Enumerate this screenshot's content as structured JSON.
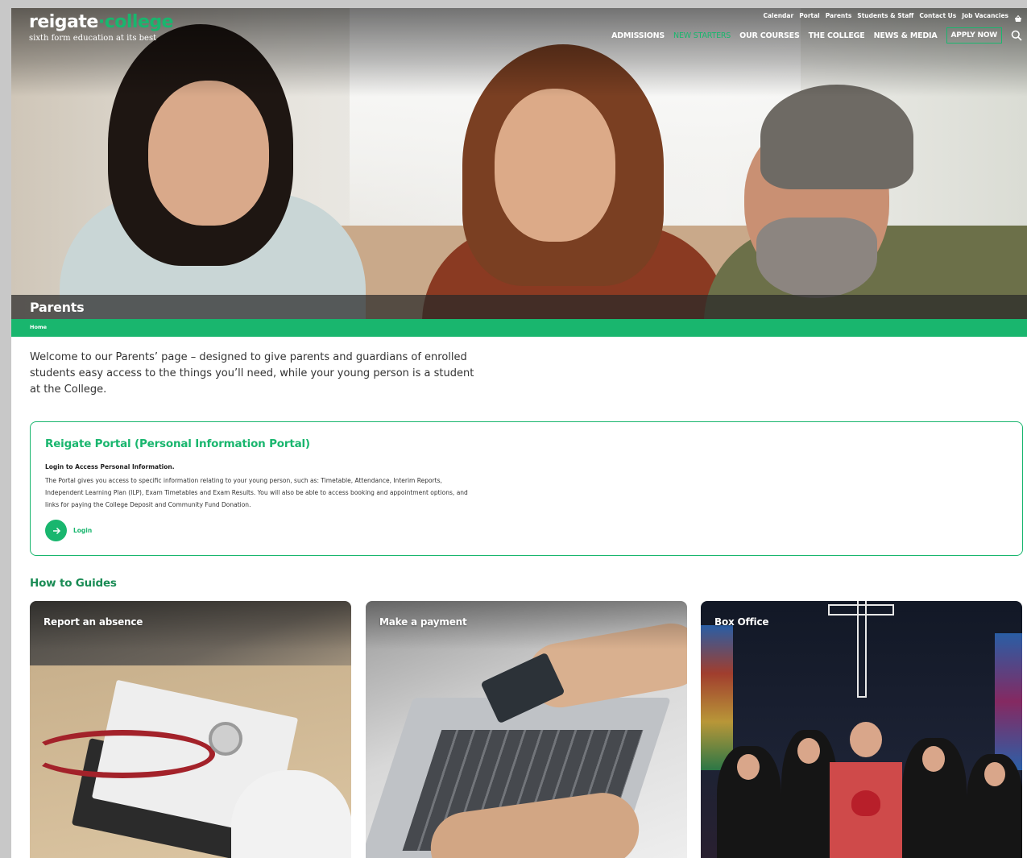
{
  "logo": {
    "name_part1": "reigate",
    "name_dot": "·",
    "name_part2": "college",
    "tagline": "sixth form education at its best"
  },
  "utility_nav": [
    "Calendar",
    "Portal",
    "Parents",
    "Students & Staff",
    "Contact Us",
    "Job Vacancies"
  ],
  "main_nav": {
    "items": [
      "ADMISSIONS",
      "NEW STARTERS",
      "OUR COURSES",
      "THE COLLEGE",
      "NEWS & MEDIA"
    ],
    "active_item": "NEW STARTERS",
    "apply_label": "APPLY NOW"
  },
  "icons": {
    "basket": "basket-icon",
    "search": "search-icon",
    "arrow": "arrow-right-icon"
  },
  "page_title": "Parents",
  "breadcrumb": "Home",
  "intro": "Welcome to our Parents’ page – designed to give parents and guardians of enrolled students easy access to the things you’ll need, while your young person is a student at the College.",
  "portal": {
    "title": "Reigate Portal (Personal Information Portal)",
    "subhead": "Login to Access Personal Information.",
    "description": "The Portal gives you access to specific information relating to your young person, such as: Timetable, Attendance, Interim Reports, Independent Learning Plan (ILP), Exam Timetables and Exam Results. You will also be able to access booking and appointment options, and links for paying the College Deposit and Community Fund Donation.",
    "login_label": "Login"
  },
  "guides": {
    "heading": "How to Guides",
    "cards": [
      {
        "label": "Report an absence"
      },
      {
        "label": "Make a payment"
      },
      {
        "label": "Box Office"
      }
    ]
  },
  "colors": {
    "brand_green": "#19b66e",
    "heading_green": "#1a8c55",
    "text": "#333333"
  }
}
